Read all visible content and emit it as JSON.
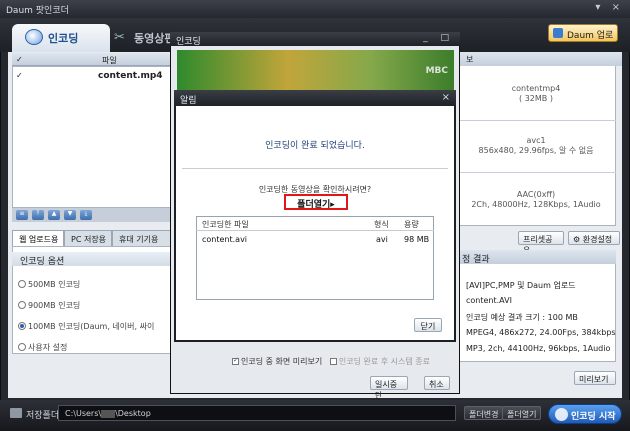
{
  "app_title": "Daum 팟인코더",
  "main_tabs": [
    {
      "label": "인코딩"
    },
    {
      "label": "동영상편"
    }
  ],
  "upload_button": "Daum 업로드",
  "file_list": {
    "header": "파일",
    "rows": [
      {
        "name": "content.mp4"
      }
    ]
  },
  "sub_tabs": [
    "웹 업로드용",
    "PC 저장용",
    "휴대 기기용"
  ],
  "options": {
    "title": "인코딩 옵션",
    "items": [
      {
        "label": "500MB 인코딩",
        "selected": false
      },
      {
        "label": "900MB 인코딩",
        "selected": false
      },
      {
        "label": "100MB 인코딩(Daum, 네이버, 싸이",
        "selected": true
      },
      {
        "label": "사용자 설정",
        "selected": false
      }
    ]
  },
  "info": {
    "header": "보",
    "file": "contentmp4",
    "size": "( 32MB )",
    "video_codec": "avc1",
    "video_detail": "856x480, 29.96fps, 알 수 없음",
    "audio_codec": "AAC(0xff)",
    "audio_detail": "2Ch, 48000Hz, 128Kbps, 1Audio",
    "share_button": "프리셋공유",
    "settings_button": "환경설정"
  },
  "result": {
    "header": "정 결과",
    "lines": [
      "[AVI]PC,PMP 및 Daum 업로드",
      "content.AVI",
      "인코딩 예상 결과 크기 : 100 MB",
      "MPEG4, 486x272, 24.00Fps, 384kbps",
      "MP3, 2ch, 44100Hz, 96kbps, 1Audio"
    ],
    "preview_button": "미리보기"
  },
  "bottom": {
    "save_label": "저장폴더",
    "path_prefix": "C:\\Users\\",
    "path_suffix": "\\Desktop",
    "change_button": "폴더변경",
    "open_button": "폴더열기",
    "start_button": "인코딩 시작"
  },
  "encoding_dialog": {
    "title": "인코딩",
    "checkbox_preview": "인코딩 중 화면 미리보기",
    "checkbox_shutdown": "인코딩 완료 후 시스템 종료",
    "pause_button": "일시중단",
    "cancel_button": "취소"
  },
  "alert": {
    "title": "알림",
    "message": "인코딩이 완료 되었습니다.",
    "question": "인코딩한 동영상을 확인하시려면?",
    "open_folder": "폴더열기",
    "table": {
      "headers": [
        "인코딩한 파일",
        "형식",
        "용량"
      ],
      "rows": [
        {
          "file": "content.avi",
          "format": "avi",
          "size": "98 MB"
        }
      ]
    },
    "close_button": "닫기"
  }
}
